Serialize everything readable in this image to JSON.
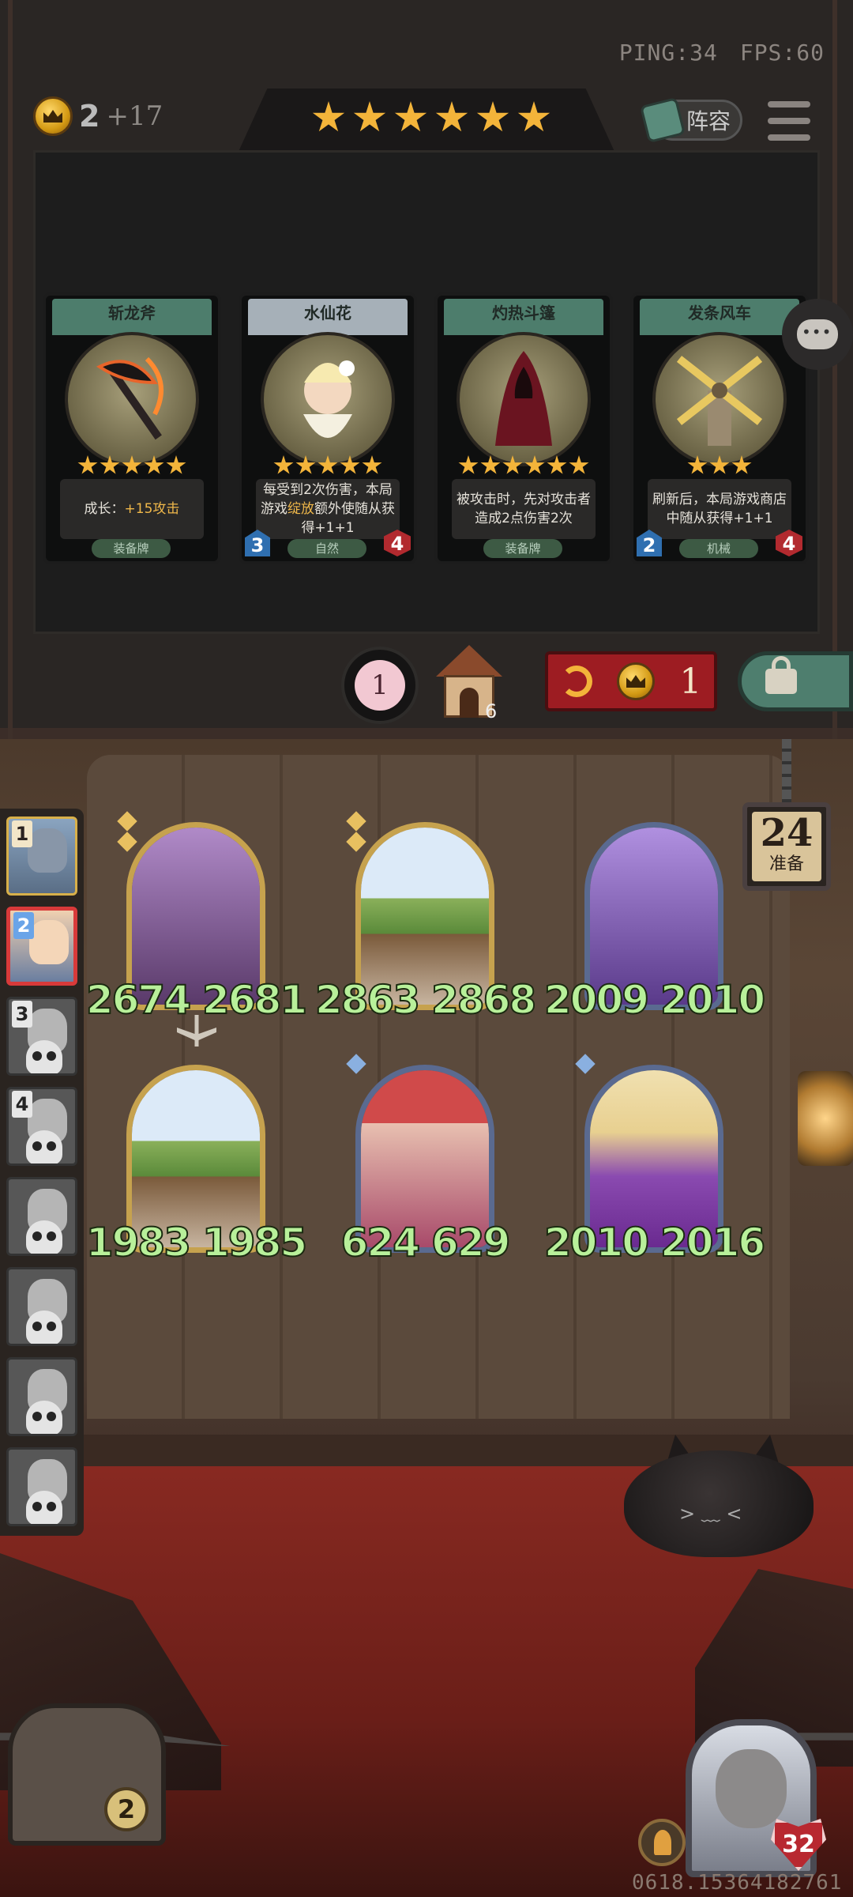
{
  "status": {
    "ping": "PING:34",
    "fps": "FPS:60"
  },
  "shop": {
    "gold": "2",
    "gold_income": "+17",
    "tavern_tier_stars": 6,
    "lineup_label": "阵容",
    "level_up_cost": "1",
    "house_count": "6",
    "refresh_cost": "1",
    "cards": [
      {
        "name": "斩龙斧",
        "stars": 5,
        "desc_pre": "成长：",
        "desc_hl": "+15攻击",
        "desc_post": "",
        "tag": "装备牌",
        "attack": "",
        "health": "",
        "art": "axe"
      },
      {
        "name": "水仙花",
        "stars": 5,
        "desc_pre": "每受到2次伤害，本局游戏",
        "desc_hl": "绽放",
        "desc_post": "额外使随从获得+1+1",
        "tag": "自然",
        "attack": "3",
        "health": "4",
        "art": "narcissus"
      },
      {
        "name": "灼热斗篷",
        "stars": 6,
        "desc_pre": "被攻击时，先对攻击者造成2点伤害2次",
        "desc_hl": "",
        "desc_post": "",
        "tag": "装备牌",
        "attack": "",
        "health": "",
        "art": "cloak"
      },
      {
        "name": "发条风车",
        "stars": 3,
        "desc_pre": "刷新后，本局游戏商店中随从获得+1+1",
        "desc_hl": "",
        "desc_post": "",
        "tag": "机械",
        "attack": "2",
        "health": "4",
        "art": "windmill"
      }
    ]
  },
  "turn": {
    "time": "24",
    "label": "准备"
  },
  "leaderboard": [
    {
      "rank": "1",
      "state": "alive"
    },
    {
      "rank": "2",
      "state": "me"
    },
    {
      "rank": "3",
      "state": "dead"
    },
    {
      "rank": "4",
      "state": "dead"
    },
    {
      "rank": "",
      "state": "dead"
    },
    {
      "rank": "",
      "state": "dead"
    },
    {
      "rank": "",
      "state": "dead"
    },
    {
      "rank": "",
      "state": "dead"
    }
  ],
  "board": [
    {
      "attack": "2674",
      "health": "2681",
      "frame": "gold",
      "gems": 2,
      "art": "elf",
      "weapon": true
    },
    {
      "attack": "2863",
      "health": "2868",
      "frame": "gold",
      "gems": 2,
      "art": "tree",
      "weapon": false
    },
    {
      "attack": "2009",
      "health": "2010",
      "frame": "blue",
      "gems": 0,
      "art": "fairy",
      "weapon": false
    },
    {
      "attack": "1983",
      "health": "1985",
      "frame": "gold",
      "gems": 0,
      "art": "tree",
      "weapon": false
    },
    {
      "attack": "624",
      "health": "629",
      "frame": "blue",
      "gems": 1,
      "art": "flower",
      "weapon": false
    },
    {
      "attack": "2010",
      "health": "2016",
      "frame": "blue",
      "gems": 1,
      "art": "dryad",
      "weapon": false
    }
  ],
  "player": {
    "chest_count": "2",
    "hero_health": "32",
    "seed": "0618.15364182761"
  },
  "colors": {
    "accent_gold": "#f3b43a",
    "stat_green": "#b8f09a",
    "refresh_red": "#9d1c22",
    "lock_green": "#4e7e6e"
  }
}
